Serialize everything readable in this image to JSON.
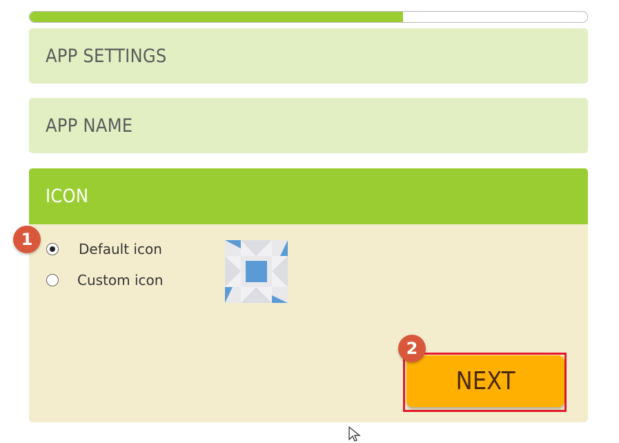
{
  "progress": {
    "value": 0.67
  },
  "sections": {
    "app_settings": "APP SETTINGS",
    "app_name": "APP NAME",
    "icon": "ICON"
  },
  "icon_options": {
    "default_label": "Default icon",
    "custom_label": "Custom icon",
    "selected": "default"
  },
  "next_button": {
    "label": "NEXT"
  },
  "badges": {
    "first": "1",
    "second": "2"
  },
  "colors": {
    "accent_green": "#9acd32",
    "light_green": "#e1efc3",
    "panel_cream": "#f4edcd",
    "button_orange": "#ffb000",
    "highlight_red": "#e5182b",
    "badge_red": "#d9583b",
    "icon_blue": "#5b9bd5"
  }
}
